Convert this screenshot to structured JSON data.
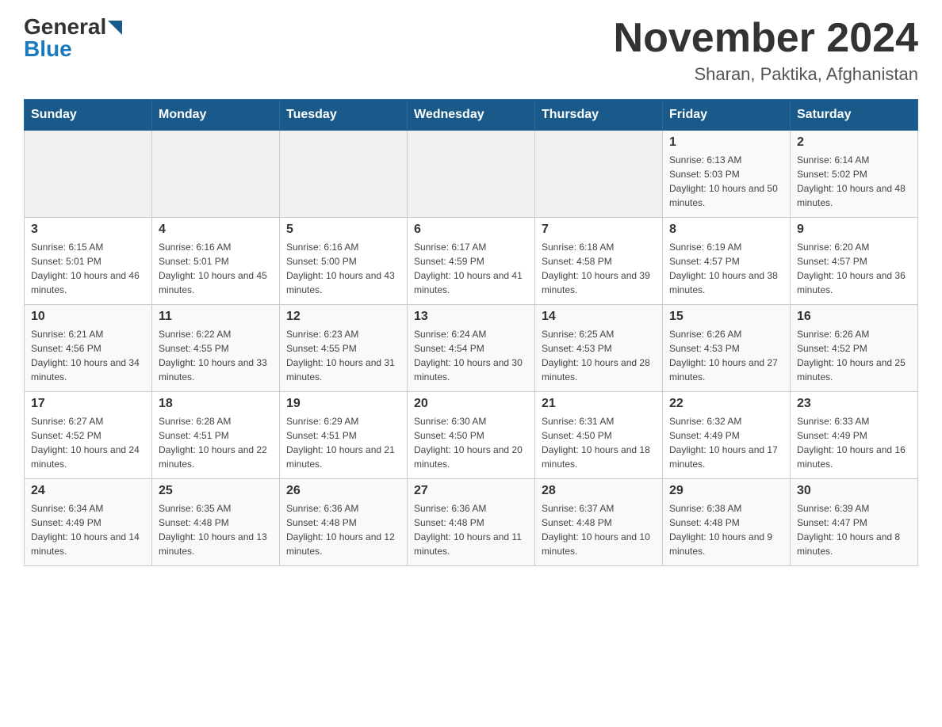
{
  "header": {
    "logo": {
      "general": "General",
      "blue": "Blue"
    },
    "title": "November 2024",
    "subtitle": "Sharan, Paktika, Afghanistan"
  },
  "days_of_week": [
    "Sunday",
    "Monday",
    "Tuesday",
    "Wednesday",
    "Thursday",
    "Friday",
    "Saturday"
  ],
  "weeks": [
    [
      {
        "day": "",
        "info": ""
      },
      {
        "day": "",
        "info": ""
      },
      {
        "day": "",
        "info": ""
      },
      {
        "day": "",
        "info": ""
      },
      {
        "day": "",
        "info": ""
      },
      {
        "day": "1",
        "info": "Sunrise: 6:13 AM\nSunset: 5:03 PM\nDaylight: 10 hours and 50 minutes."
      },
      {
        "day": "2",
        "info": "Sunrise: 6:14 AM\nSunset: 5:02 PM\nDaylight: 10 hours and 48 minutes."
      }
    ],
    [
      {
        "day": "3",
        "info": "Sunrise: 6:15 AM\nSunset: 5:01 PM\nDaylight: 10 hours and 46 minutes."
      },
      {
        "day": "4",
        "info": "Sunrise: 6:16 AM\nSunset: 5:01 PM\nDaylight: 10 hours and 45 minutes."
      },
      {
        "day": "5",
        "info": "Sunrise: 6:16 AM\nSunset: 5:00 PM\nDaylight: 10 hours and 43 minutes."
      },
      {
        "day": "6",
        "info": "Sunrise: 6:17 AM\nSunset: 4:59 PM\nDaylight: 10 hours and 41 minutes."
      },
      {
        "day": "7",
        "info": "Sunrise: 6:18 AM\nSunset: 4:58 PM\nDaylight: 10 hours and 39 minutes."
      },
      {
        "day": "8",
        "info": "Sunrise: 6:19 AM\nSunset: 4:57 PM\nDaylight: 10 hours and 38 minutes."
      },
      {
        "day": "9",
        "info": "Sunrise: 6:20 AM\nSunset: 4:57 PM\nDaylight: 10 hours and 36 minutes."
      }
    ],
    [
      {
        "day": "10",
        "info": "Sunrise: 6:21 AM\nSunset: 4:56 PM\nDaylight: 10 hours and 34 minutes."
      },
      {
        "day": "11",
        "info": "Sunrise: 6:22 AM\nSunset: 4:55 PM\nDaylight: 10 hours and 33 minutes."
      },
      {
        "day": "12",
        "info": "Sunrise: 6:23 AM\nSunset: 4:55 PM\nDaylight: 10 hours and 31 minutes."
      },
      {
        "day": "13",
        "info": "Sunrise: 6:24 AM\nSunset: 4:54 PM\nDaylight: 10 hours and 30 minutes."
      },
      {
        "day": "14",
        "info": "Sunrise: 6:25 AM\nSunset: 4:53 PM\nDaylight: 10 hours and 28 minutes."
      },
      {
        "day": "15",
        "info": "Sunrise: 6:26 AM\nSunset: 4:53 PM\nDaylight: 10 hours and 27 minutes."
      },
      {
        "day": "16",
        "info": "Sunrise: 6:26 AM\nSunset: 4:52 PM\nDaylight: 10 hours and 25 minutes."
      }
    ],
    [
      {
        "day": "17",
        "info": "Sunrise: 6:27 AM\nSunset: 4:52 PM\nDaylight: 10 hours and 24 minutes."
      },
      {
        "day": "18",
        "info": "Sunrise: 6:28 AM\nSunset: 4:51 PM\nDaylight: 10 hours and 22 minutes."
      },
      {
        "day": "19",
        "info": "Sunrise: 6:29 AM\nSunset: 4:51 PM\nDaylight: 10 hours and 21 minutes."
      },
      {
        "day": "20",
        "info": "Sunrise: 6:30 AM\nSunset: 4:50 PM\nDaylight: 10 hours and 20 minutes."
      },
      {
        "day": "21",
        "info": "Sunrise: 6:31 AM\nSunset: 4:50 PM\nDaylight: 10 hours and 18 minutes."
      },
      {
        "day": "22",
        "info": "Sunrise: 6:32 AM\nSunset: 4:49 PM\nDaylight: 10 hours and 17 minutes."
      },
      {
        "day": "23",
        "info": "Sunrise: 6:33 AM\nSunset: 4:49 PM\nDaylight: 10 hours and 16 minutes."
      }
    ],
    [
      {
        "day": "24",
        "info": "Sunrise: 6:34 AM\nSunset: 4:49 PM\nDaylight: 10 hours and 14 minutes."
      },
      {
        "day": "25",
        "info": "Sunrise: 6:35 AM\nSunset: 4:48 PM\nDaylight: 10 hours and 13 minutes."
      },
      {
        "day": "26",
        "info": "Sunrise: 6:36 AM\nSunset: 4:48 PM\nDaylight: 10 hours and 12 minutes."
      },
      {
        "day": "27",
        "info": "Sunrise: 6:36 AM\nSunset: 4:48 PM\nDaylight: 10 hours and 11 minutes."
      },
      {
        "day": "28",
        "info": "Sunrise: 6:37 AM\nSunset: 4:48 PM\nDaylight: 10 hours and 10 minutes."
      },
      {
        "day": "29",
        "info": "Sunrise: 6:38 AM\nSunset: 4:48 PM\nDaylight: 10 hours and 9 minutes."
      },
      {
        "day": "30",
        "info": "Sunrise: 6:39 AM\nSunset: 4:47 PM\nDaylight: 10 hours and 8 minutes."
      }
    ]
  ]
}
